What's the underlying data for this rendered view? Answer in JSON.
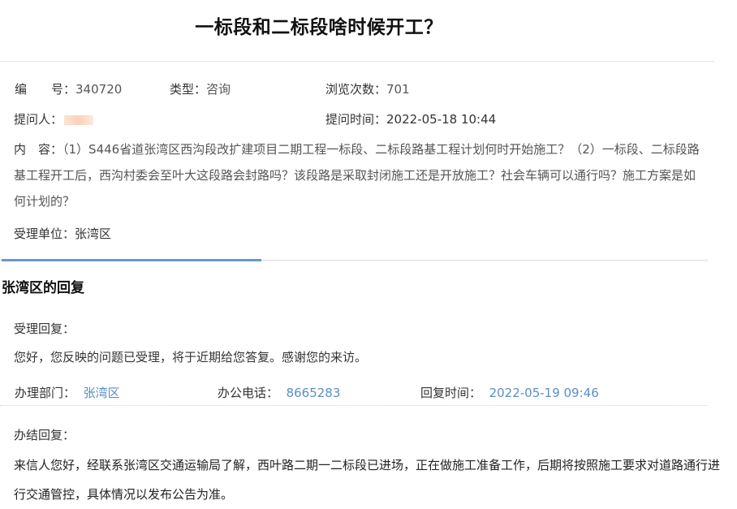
{
  "title": "一标段和二标段啥时候开工？",
  "meta": {
    "id_label": "编　　号：",
    "id_value": "340720",
    "type_label": "类型：",
    "type_value": "咨询",
    "views_label": "浏览次数：",
    "views_value": "701",
    "asker_label": "提问人：",
    "time_label": "提问时间：",
    "time_value": "2022-05-18 10:44",
    "content_label": "内　容：",
    "content_text": "（1）S446省道张湾区西沟段改扩建项目二期工程一标段、二标段路基工程计划何时开始施工？（2）一标段、二标段路基工程开工后，西沟村委会至叶大这段路会封路吗？该段路是采取封闭施工还是开放施工？社会车辆可以通行吗？施工方案是如何计划的？",
    "unit_label": "受理单位：",
    "unit_value": "张湾区"
  },
  "reply": {
    "section_title": "张湾区的回复",
    "accept_label": "受理回复：",
    "accept_text": "您好，您反映的问题已受理，将于近期给您答复。感谢您的来访。",
    "dept_label": "办理部门：",
    "dept_value": "张湾区",
    "phone_label": "办公电话：",
    "phone_value": "8665283",
    "reply_time_label": "回复时间：",
    "reply_time_value": "2022-05-19 09:46",
    "final_label": "办结回复：",
    "final_text": "来信人您好，经联系张湾区交通运输局了解，西叶路二期一二标段已进场，正在做施工准备工作，后期将按照施工要求对道路通行进行交通管控，具体情况以发布公告为准。"
  }
}
